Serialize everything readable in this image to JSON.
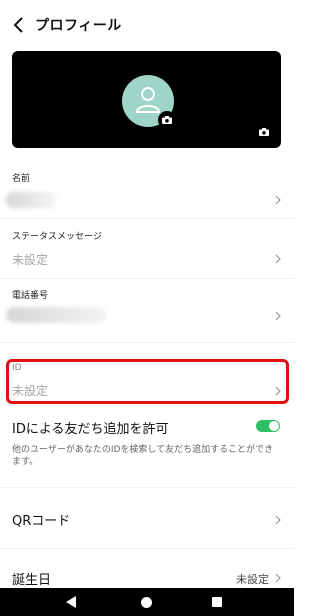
{
  "header": {
    "title": "プロフィール"
  },
  "fields": {
    "name": {
      "label": "名前"
    },
    "status": {
      "label": "ステータスメッセージ",
      "value": "未設定"
    },
    "phone": {
      "label": "電話番号"
    },
    "id": {
      "label": "ID",
      "value": "未設定"
    }
  },
  "id_search": {
    "label": "IDによる友だち追加を許可",
    "description": "他のユーザーがあなたのIDを検索して友だち追加することができます。",
    "enabled": true,
    "toggle_color": "#2ebf64"
  },
  "qr": {
    "label": "QRコード"
  },
  "birthday": {
    "label": "誕生日",
    "value": "未設定"
  },
  "colors": {
    "highlight": "#e01010",
    "avatar_bg": "#9ed5c7"
  }
}
